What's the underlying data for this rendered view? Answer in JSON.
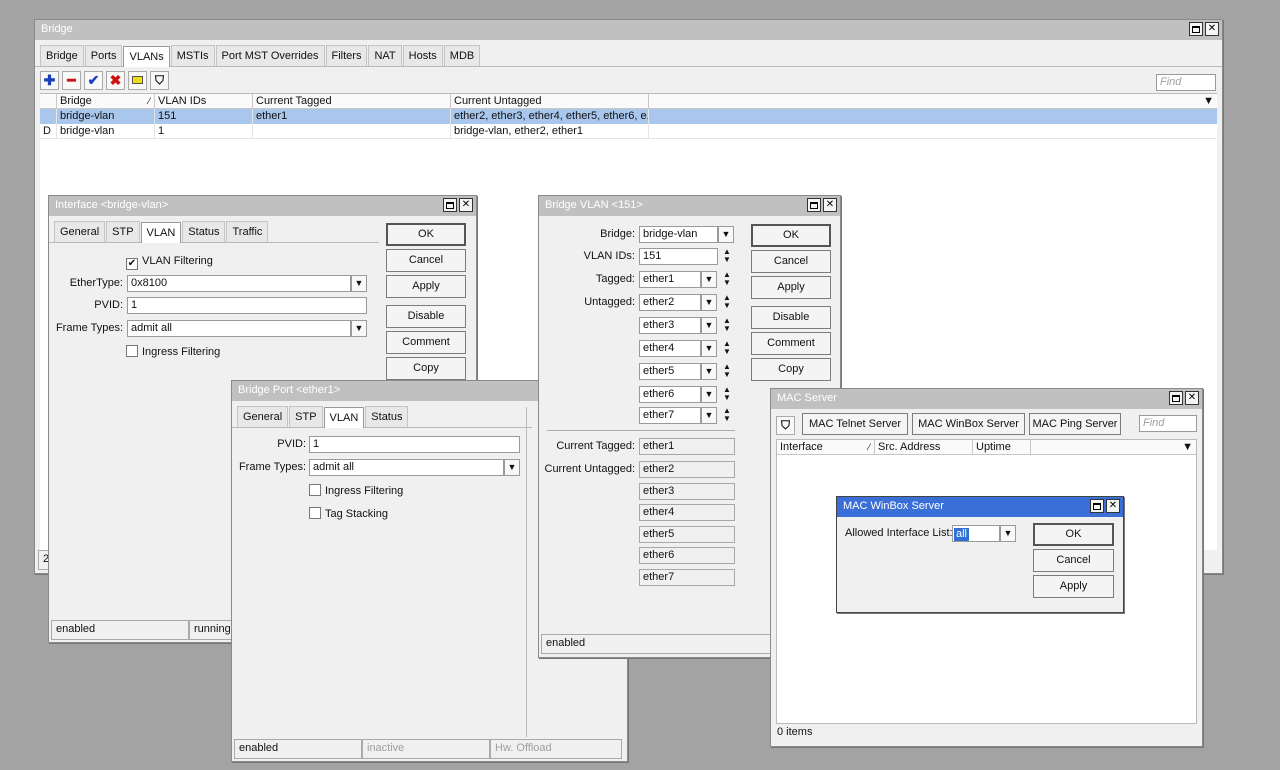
{
  "bridge": {
    "title": "Bridge",
    "tabs": [
      "Bridge",
      "Ports",
      "VLANs",
      "MSTIs",
      "Port MST Overrides",
      "Filters",
      "NAT",
      "Hosts",
      "MDB"
    ],
    "find_placeholder": "Find",
    "columns": [
      "Bridge",
      "VLAN IDs",
      "Current Tagged",
      "Current Untagged"
    ],
    "rows": [
      {
        "flag": "",
        "bridge": "bridge-vlan",
        "vlan_ids": "151",
        "tagged": "ether1",
        "untagged": "ether2, ether3, ether4, ether5, ether6, e..."
      },
      {
        "flag": "D",
        "bridge": "bridge-vlan",
        "vlan_ids": "1",
        "tagged": "",
        "untagged": "bridge-vlan, ether2, ether1"
      }
    ],
    "count_fragment": "2"
  },
  "iface": {
    "title": "Interface <bridge-vlan>",
    "tabs": [
      "General",
      "STP",
      "VLAN",
      "Status",
      "Traffic"
    ],
    "vlan_filtering": "VLAN Filtering",
    "ethertype_label": "EtherType:",
    "ethertype_value": "0x8100",
    "pvid_label": "PVID:",
    "pvid_value": "1",
    "frame_label": "Frame Types:",
    "frame_value": "admit all",
    "ingress": "Ingress Filtering",
    "buttons": [
      "OK",
      "Cancel",
      "Apply",
      "Disable",
      "Comment",
      "Copy"
    ],
    "status_enabled": "enabled",
    "status_running": "running"
  },
  "port": {
    "title": "Bridge Port <ether1>",
    "tabs": [
      "General",
      "STP",
      "VLAN",
      "Status"
    ],
    "pvid_label": "PVID:",
    "pvid_value": "1",
    "frame_label": "Frame Types:",
    "frame_value": "admit all",
    "ingress": "Ingress Filtering",
    "tag_stacking": "Tag Stacking",
    "status_enabled": "enabled",
    "status_inactive": "inactive",
    "status_hw": "Hw. Offload"
  },
  "bvlan": {
    "title": "Bridge VLAN <151>",
    "bridge_label": "Bridge:",
    "bridge_value": "bridge-vlan",
    "vlanids_label": "VLAN IDs:",
    "vlanids_value": "151",
    "tagged_label": "Tagged:",
    "tagged_value": "ether1",
    "untagged_label": "Untagged:",
    "untagged_values": [
      "ether2",
      "ether3",
      "ether4",
      "ether5",
      "ether6",
      "ether7"
    ],
    "cur_tagged_label": "Current Tagged:",
    "cur_tagged_value": "ether1",
    "cur_untagged_label": "Current Untagged:",
    "cur_untagged_values": [
      "ether2",
      "ether3",
      "ether4",
      "ether5",
      "ether6",
      "ether7"
    ],
    "buttons": [
      "OK",
      "Cancel",
      "Apply",
      "Disable",
      "Comment",
      "Copy"
    ],
    "status_enabled": "enabled"
  },
  "mac": {
    "title": "MAC Server",
    "buttons": [
      "MAC Telnet Server",
      "MAC WinBox Server",
      "MAC Ping Server"
    ],
    "find_placeholder": "Find",
    "columns": [
      "Interface",
      "Src. Address",
      "Uptime"
    ],
    "items": "0 items"
  },
  "winbox": {
    "title": "MAC WinBox Server",
    "label": "Allowed Interface List:",
    "value": "all",
    "buttons": [
      "OK",
      "Cancel",
      "Apply"
    ]
  }
}
